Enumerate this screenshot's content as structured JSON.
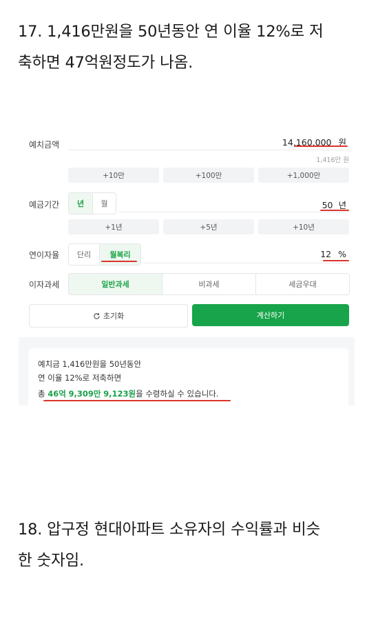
{
  "post": {
    "item17_line1": "17. 1,416만원을 50년동안 연 이율 12%로 저",
    "item17_line2": "축하면 47억원정도가 나옴.",
    "item18_line1": "18. 압구정 현대아파트 소유자의 수익률과 비슷",
    "item18_line2": "한 숫자임."
  },
  "calculator": {
    "deposit": {
      "label": "예치금액",
      "value": "14,160,000",
      "unit": "원",
      "subtext": "1,416만 원",
      "quick_buttons": [
        "+10만",
        "+100만",
        "+1,000만"
      ]
    },
    "period": {
      "label": "예금기간",
      "options": [
        "년",
        "월"
      ],
      "selected": "년",
      "value": "50",
      "unit": "년",
      "quick_buttons": [
        "+1년",
        "+5년",
        "+10년"
      ]
    },
    "rate": {
      "label": "연이자율",
      "options": [
        "단리",
        "월복리"
      ],
      "selected": "월복리",
      "value": "12",
      "unit": "%"
    },
    "tax": {
      "label": "이자과세",
      "options": [
        "일반과세",
        "비과세",
        "세금우대"
      ],
      "selected": "일반과세"
    },
    "reset_label": "초기화",
    "calculate_label": "계산하기",
    "result": {
      "line1": "예치금 1,416만원을 50년동안",
      "line2": "연 이율 12%로 저축하면",
      "line3_prefix": "총 ",
      "amount_eok": "46억",
      "amount_man": "9,309만",
      "amount_won": "9,123원",
      "line3_suffix": "을 수령하실 수 있습니다."
    }
  },
  "colors": {
    "accent_green": "#17a44a",
    "underline_red": "#d9342b"
  }
}
